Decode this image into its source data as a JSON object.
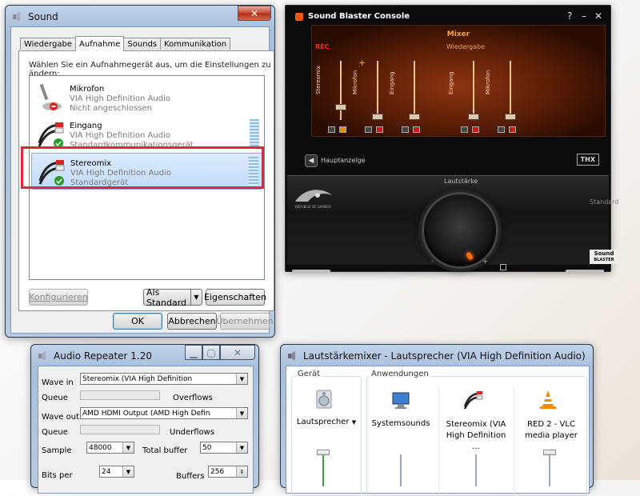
{
  "sound": {
    "title": "Sound",
    "tabs": [
      "Wiedergabe",
      "Aufnahme",
      "Sounds",
      "Kommunikation"
    ],
    "active_tab": "Aufnahme",
    "instruction": "Wählen Sie ein Aufnahmegerät aus, um die Einstellungen zu ändern:",
    "devices": [
      {
        "name": "Mikrofon",
        "driver": "VIA High Definition Audio",
        "status": "Nicht angeschlossen"
      },
      {
        "name": "Eingang",
        "driver": "VIA High Definition Audio",
        "status": "Standardkommunikationsgerät"
      },
      {
        "name": "Stereomix",
        "driver": "VIA High Definition Audio",
        "status": "Standardgerät"
      }
    ],
    "buttons": {
      "configure": "Konfigurieren",
      "set_default": "Als Standard",
      "properties": "Eigenschaften",
      "ok": "OK",
      "cancel": "Abbrechen",
      "apply": "Übernehmen"
    }
  },
  "soundblaster": {
    "title": "Sound Blaster Console",
    "help": "?",
    "minimize": "–",
    "close": "✕",
    "mixer_title": "Mixer",
    "mixer_sub": "Wiedergabe",
    "rec": "REC",
    "plus": "+",
    "channels": [
      "Stereomix",
      "Mikrofon",
      "Eingang",
      "Eingang",
      "Mikrofon"
    ],
    "nav_label": "Hauptanzeige",
    "thx": "THX",
    "volume_label": "Lautstärke",
    "standard": "Standard",
    "minus_sign": "-",
    "plus_sign": "+",
    "brand_line1": "Sound",
    "brand_line2": "BLASTER",
    "rog_text": "REPUBLIC OF GAMERS"
  },
  "repeater": {
    "title": "Audio Repeater 1.20",
    "wave_in_label": "Wave in",
    "wave_in_value": "Stereomix (VIA High Definition",
    "queue_label_1": "Queue",
    "overflows_label": "Overflows",
    "wave_out_label": "Wave out",
    "wave_out_value": "AMD HDMI Output (AMD High Defin",
    "queue_label_2": "Queue",
    "underflows_label": "Underflows",
    "sample_label": "Sample",
    "sample_value": "48000",
    "total_buffer_label": "Total buffer",
    "total_buffer_value": "50",
    "bits_label": "Bits per",
    "bits_value": "24",
    "buffers_label": "Buffers",
    "buffers_value": "256"
  },
  "volmixer": {
    "title": "Lautstärkemixer - Lautsprecher (VIA High Definition Audio)",
    "device_group": "Gerät",
    "apps_group": "Anwendungen",
    "device_name": "Lautsprecher",
    "apps": [
      "Systemsounds",
      "Stereomix (VIA High Definition ...",
      "RED 2 - VLC media player"
    ],
    "speaker_level": 1.0
  },
  "colors": {
    "accent_red": "#e0283a",
    "sb_orange": "#f0a44a",
    "win_title_bar": "#b8cae0"
  }
}
